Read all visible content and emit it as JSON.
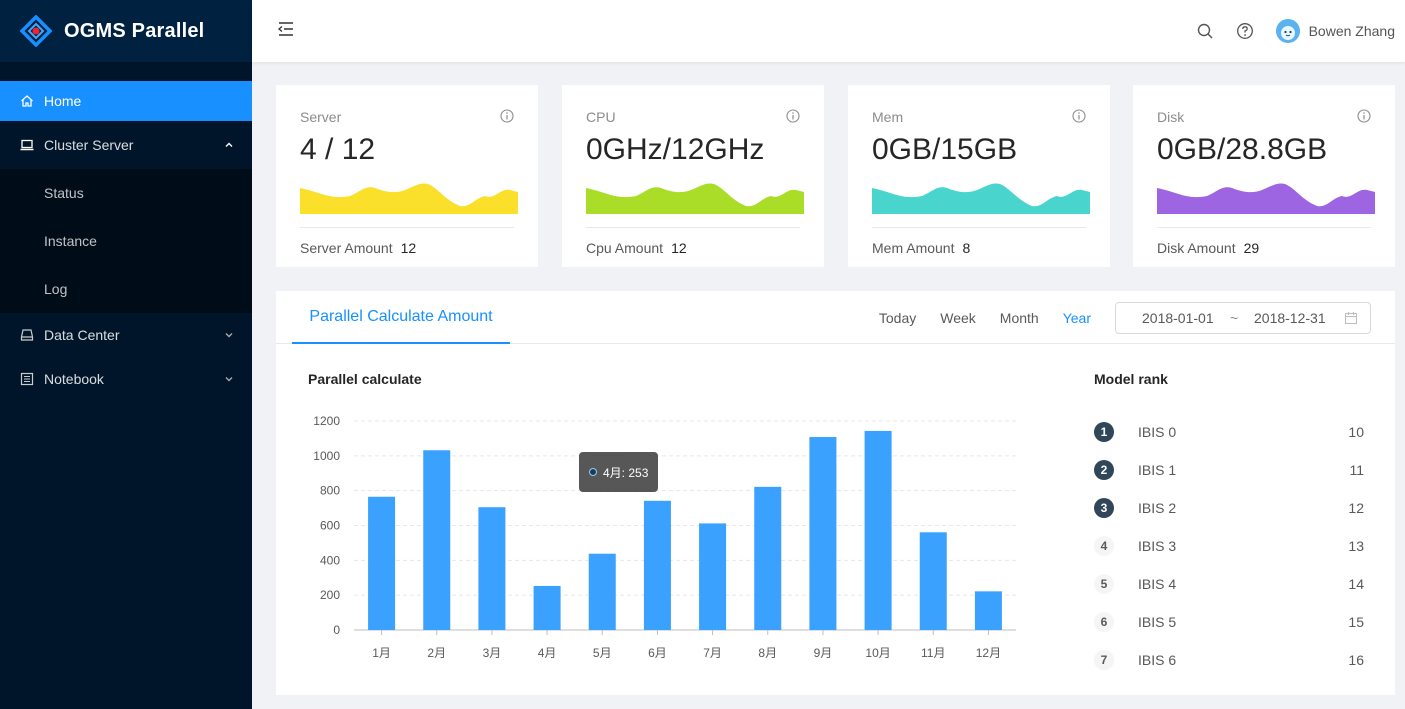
{
  "app": {
    "title": "OGMS Parallel"
  },
  "sidebar": {
    "items": [
      {
        "label": "Home",
        "icon": "home-icon",
        "active": true
      },
      {
        "label": "Cluster Server",
        "icon": "laptop-icon",
        "expanded": true,
        "children": [
          {
            "label": "Status"
          },
          {
            "label": "Instance"
          },
          {
            "label": "Log"
          }
        ]
      },
      {
        "label": "Data Center",
        "icon": "database-icon",
        "expanded": false
      },
      {
        "label": "Notebook",
        "icon": "notebook-icon",
        "expanded": false
      }
    ]
  },
  "header": {
    "user_name": "Bowen Zhang",
    "icons": [
      "menu-fold-icon",
      "search-icon",
      "question-icon"
    ]
  },
  "cards": [
    {
      "title": "Server",
      "value": "4 / 12",
      "footer_label": "Server Amount",
      "footer_value": "12",
      "color": "#fadb14"
    },
    {
      "title": "CPU",
      "value": "0GHz/12GHz",
      "footer_label": "Cpu Amount",
      "footer_value": "12",
      "color": "#a0d911"
    },
    {
      "title": "Mem",
      "value": "0GB/15GB",
      "footer_label": "Mem Amount",
      "footer_value": "8",
      "color": "#36cfc9"
    },
    {
      "title": "Disk",
      "value": "0GB/28.8GB",
      "footer_label": "Disk Amount",
      "footer_value": "29",
      "color": "#9254de"
    }
  ],
  "panel": {
    "tab": "Parallel Calculate Amount",
    "ranges": [
      "Today",
      "Week",
      "Month",
      "Year"
    ],
    "selected_range": "Year",
    "date_start": "2018-01-01",
    "date_sep": "~",
    "date_end": "2018-12-31",
    "chart_title": "Parallel calculate",
    "rank_title": "Model rank",
    "tooltip": "4月: 253"
  },
  "chart_data": {
    "type": "bar",
    "categories": [
      "1月",
      "2月",
      "3月",
      "4月",
      "5月",
      "6月",
      "7月",
      "8月",
      "9月",
      "10月",
      "11月",
      "12月"
    ],
    "values": [
      765,
      1032,
      705,
      253,
      438,
      742,
      612,
      822,
      1108,
      1143,
      561,
      222
    ],
    "ylim": [
      0,
      1200
    ],
    "yticks": [
      0,
      200,
      400,
      600,
      800,
      1000,
      1200
    ],
    "grid": true,
    "color": "#3ba1ff",
    "title": "Parallel calculate",
    "xlabel": "",
    "ylabel": ""
  },
  "rank": [
    {
      "rank": "1",
      "name": "IBIS 0",
      "value": "10"
    },
    {
      "rank": "2",
      "name": "IBIS 1",
      "value": "11"
    },
    {
      "rank": "3",
      "name": "IBIS 2",
      "value": "12"
    },
    {
      "rank": "4",
      "name": "IBIS 3",
      "value": "13"
    },
    {
      "rank": "5",
      "name": "IBIS 4",
      "value": "14"
    },
    {
      "rank": "6",
      "name": "IBIS 5",
      "value": "15"
    },
    {
      "rank": "7",
      "name": "IBIS 6",
      "value": "16"
    }
  ]
}
